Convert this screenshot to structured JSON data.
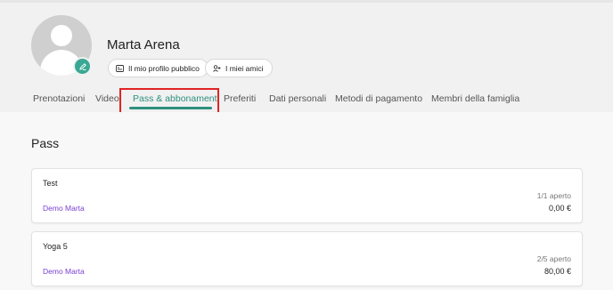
{
  "profile": {
    "name": "Marta Arena",
    "buttons": {
      "public_profile": "Il mio profilo pubblico",
      "friends": "I miei amici"
    }
  },
  "tabs": [
    {
      "label": "Prenotazioni",
      "active": false
    },
    {
      "label": "Video",
      "active": false
    },
    {
      "label": "Pass & abbonamenti",
      "active": true
    },
    {
      "label": "Preferiti",
      "active": false
    },
    {
      "label": "Dati personali",
      "active": false
    },
    {
      "label": "Metodi di pagamento",
      "active": false
    },
    {
      "label": "Membri della famiglia",
      "active": false
    }
  ],
  "section": {
    "title": "Pass"
  },
  "passes": [
    {
      "title": "Test",
      "owner": "Demo Marta",
      "status": "1/1 aperto",
      "price": "0,00 €"
    },
    {
      "title": "Yoga 5",
      "owner": "Demo Marta",
      "status": "2/5 aperto",
      "price": "80,00 €"
    }
  ],
  "colors": {
    "accent": "#2e8f7f",
    "badge": "#3aa894",
    "owner_link": "#7a3fd1",
    "highlight": "#e02424"
  },
  "icons": {
    "avatar": "user-silhouette-icon",
    "edit": "pencil-icon",
    "public_profile": "id-card-icon",
    "friends": "add-user-icon"
  }
}
